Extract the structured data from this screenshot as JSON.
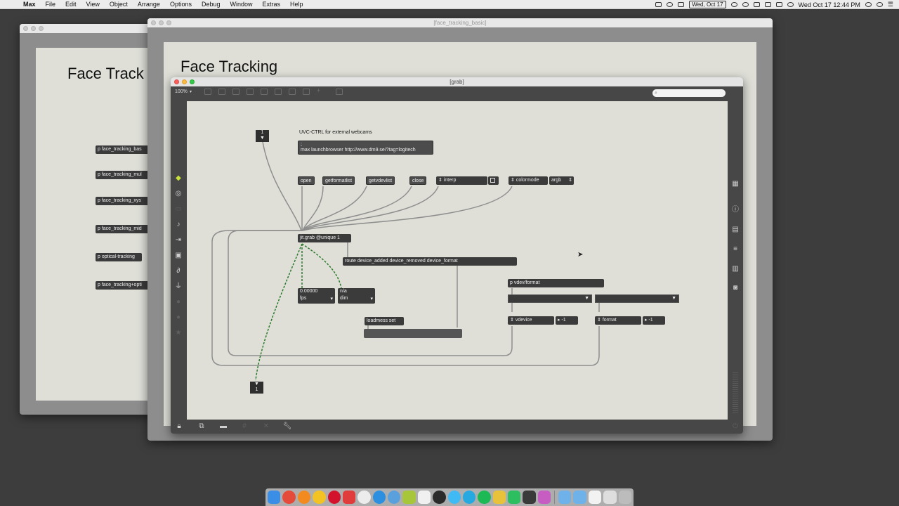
{
  "menubar": {
    "apple": "",
    "items": [
      "Max",
      "File",
      "Edit",
      "View",
      "Object",
      "Arrange",
      "Options",
      "Debug",
      "Window",
      "Extras",
      "Help"
    ],
    "date_badge": "Wed, Oct 17",
    "clock": "Wed Oct 17  12:44 PM"
  },
  "back_window": {
    "title_text": "Face Track",
    "subpatchers": [
      "p face_tracking_bas",
      "p face_tracking_mul",
      "p face_tracking_xys",
      "p face_tracking_mid",
      "p optical-tracking",
      "p face_tracking+opti"
    ]
  },
  "mid_window": {
    "title": "[face_tracking_basic]",
    "heading": "Face Tracking"
  },
  "grab_window": {
    "title": "[grab]",
    "zoom": "100%",
    "inlet_number": "1",
    "outlet_number": "1",
    "comment": "UVC-CTRL for external webcams",
    "browser_msg_line1": ";",
    "browser_msg_line2": "max launchbrowser http://www.dm9.se/?tag=logitech",
    "buttons": {
      "open": "open",
      "getformatlist": "getformatlist",
      "getvdevlist": "getvdevlist",
      "close": "close"
    },
    "interp_label": "interp",
    "colormode_label": "colormode",
    "colormode_value": "argb",
    "grab_object": "jit.grab @unique 1",
    "route_object": "route device_added device_removed device_format",
    "fps_value": "0.00000",
    "fps_label": "fps",
    "dim_value": "n/a",
    "dim_label": "dim",
    "loadmess": "loadmess set",
    "vdev_object": "p vdev/format",
    "vdevice_label": "vdevice",
    "vdevice_value": "-1",
    "format_label": "format",
    "format_value": "-1"
  },
  "colors": {
    "patch_bg": "#dfdfd8",
    "object_bg": "#3b3b3b",
    "signal_cord": "#2a7a2a",
    "cord": "#8e8e8e"
  }
}
